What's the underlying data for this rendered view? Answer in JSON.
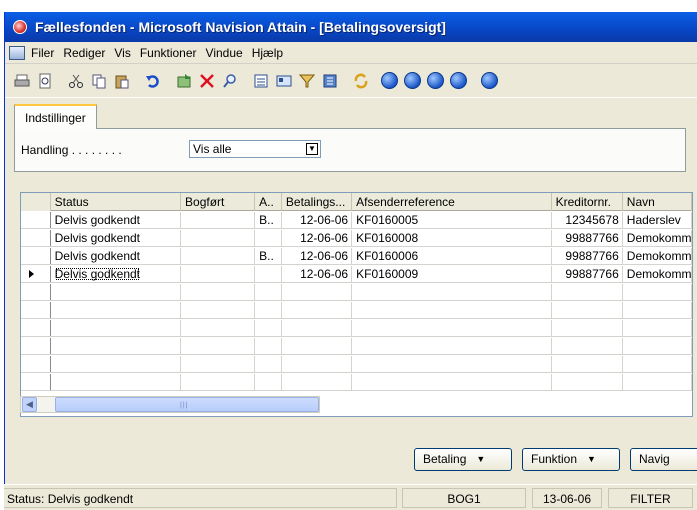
{
  "window": {
    "title": "Fællesfonden - Microsoft Navision Attain - [Betalingsoversigt]"
  },
  "menu": [
    "Filer",
    "Rediger",
    "Vis",
    "Funktioner",
    "Vindue",
    "Hjælp"
  ],
  "tab": {
    "label": "Indstillinger",
    "field_label": "Handling . . . . . . . .",
    "field_value": "Vis alle"
  },
  "grid": {
    "columns": [
      "Status",
      "Bogført",
      "A..",
      "Betalings...",
      "Afsenderreference",
      "Kreditornr.",
      "Navn"
    ],
    "rows": [
      [
        "Delvis godkendt",
        "",
        "B..",
        "12-06-06",
        "KF0160005",
        "12345678",
        "Haderslev"
      ],
      [
        "Delvis godkendt",
        "",
        "",
        "12-06-06",
        "KF0160008",
        "99887766",
        "Demokomm"
      ],
      [
        "Delvis godkendt",
        "",
        "B..",
        "12-06-06",
        "KF0160006",
        "99887766",
        "Demokomm"
      ],
      [
        "Delvis godkendt",
        "",
        "",
        "12-06-06",
        "KF0160009",
        "99887766",
        "Demokomm"
      ]
    ]
  },
  "buttons": {
    "betaling": "Betaling",
    "funktion": "Funktion",
    "navig": "Navig"
  },
  "status": {
    "text": "Status: Delvis godkendt",
    "user": "BOG1",
    "date": "13-06-06",
    "filter": "FILTER"
  }
}
